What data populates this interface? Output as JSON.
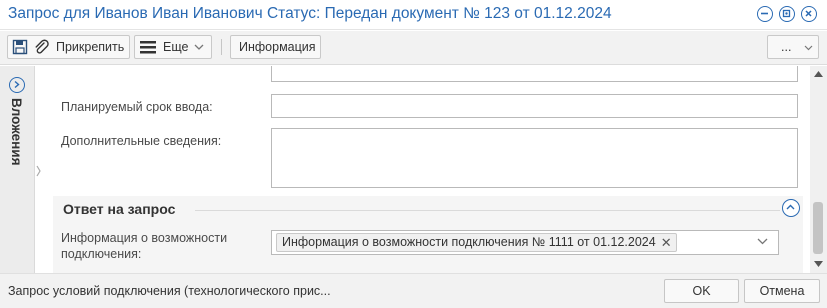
{
  "window": {
    "title": "Запрос для Иванов Иван Иванович Статус: Передан документ № 123 от 01.12.2024",
    "accent_color": "#2a6ab3",
    "controls": [
      "minimize-icon",
      "settings-icon",
      "close-icon"
    ]
  },
  "toolbar": {
    "attach_label": "Прикрепить",
    "more_label": "Еще",
    "info_label": "Информация",
    "ellipsis_label": "...",
    "icons": [
      "save-icon",
      "paperclip-icon",
      "menu-icon",
      "chevron-down-icon"
    ]
  },
  "sidebar": {
    "label": "Вложения",
    "icon": "chevron-right-circle-icon"
  },
  "form": {
    "planned_date_label": "Планируемый срок ввода:",
    "planned_date_value": "",
    "extra_info_label": "Дополнительные сведения:",
    "extra_info_value": ""
  },
  "response_section": {
    "title": "Ответ на запрос",
    "collapse_icon": "chevron-up-circle-icon",
    "info_label": "Информация о возможности подключения:",
    "info_label_line1": "Информация о возможности",
    "info_label_line2": "подключения:",
    "info_value": "Информация о возможности подключения № 1111 от 01.12.2024",
    "chip_remove_glyph": "✕"
  },
  "footer": {
    "status_text": "Запрос условий подключения (технологического прис...",
    "ok_label": "OK",
    "cancel_label": "Отмена"
  }
}
